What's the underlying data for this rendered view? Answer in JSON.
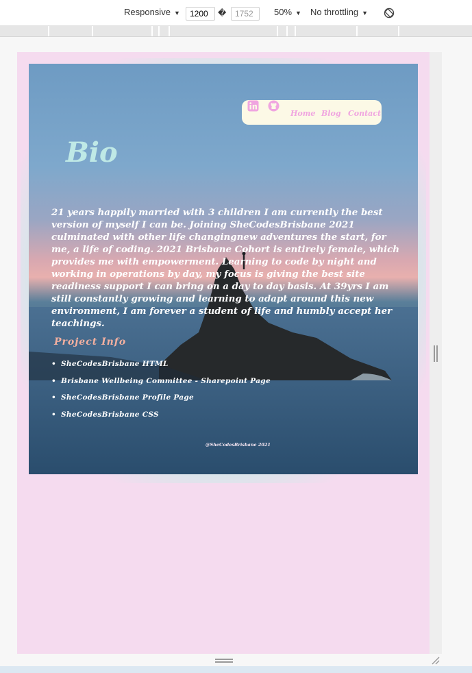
{
  "devtools": {
    "device": "Responsive",
    "width": "1200",
    "dim_separator": "�",
    "height": "1752",
    "zoom": "50%",
    "throttling": "No throttling"
  },
  "nav": {
    "icons": [
      "linkedin-icon",
      "github-icon"
    ],
    "links": [
      "Home",
      "Blog",
      "Contact"
    ],
    "color": "#f0a5e0",
    "background": "#fcf9e6"
  },
  "bio": {
    "title": "Bio",
    "text": "21 years happily married with 3 children I am currently the best version of myself I can be. Joining SheCodesBrisbane 2021 culminated with other life changingnew adventures the start, for me, a life of coding. 2021 Brisbane Cohort is entirely female, which provides me with empowerment. Learning to code by night and working in operations by day, my focus is giving the best site readiness support I can bring on a day to day basis. At 39yrs I am still constantly growing and learning to adapt around this new environment, I am forever a student of life and humbly accept her teachings."
  },
  "projects": {
    "title": "Project Info",
    "items": [
      "SheCodesBrisbane HTML",
      "Brisbane Wellbeing Committee - Sharepoint Page",
      "SheCodesBrisbane Profile Page",
      "SheCodesBrisbane CSS"
    ]
  },
  "footer": "@SheCodesBrisbane 2021",
  "colors": {
    "page_background": "#f5dbef",
    "title": "#bfe9e6",
    "project_title": "#f4b0a0"
  }
}
